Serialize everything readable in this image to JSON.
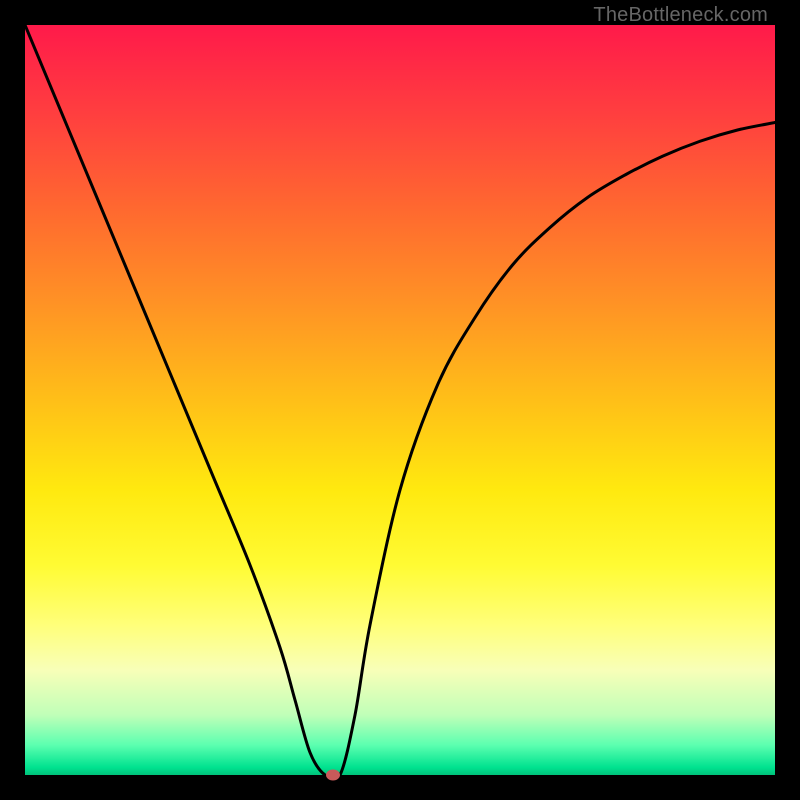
{
  "watermark": "TheBottleneck.com",
  "chart_data": {
    "type": "line",
    "title": "",
    "xlabel": "",
    "ylabel": "",
    "xlim": [
      0,
      100
    ],
    "ylim": [
      0,
      100
    ],
    "series": [
      {
        "name": "curve",
        "x": [
          0.0,
          5.0,
          10.0,
          15.0,
          20.0,
          25.0,
          30.0,
          34.0,
          36.0,
          38.0,
          40.0,
          42.0,
          44.0,
          46.0,
          50.0,
          55.0,
          60.0,
          65.0,
          70.0,
          75.0,
          80.0,
          85.0,
          90.0,
          95.0,
          100.0
        ],
        "values": [
          100.0,
          88.0,
          76.0,
          64.0,
          52.0,
          40.0,
          28.0,
          17.0,
          10.0,
          3.0,
          0.0,
          0.0,
          8.0,
          20.0,
          38.0,
          52.0,
          61.0,
          68.0,
          73.0,
          77.0,
          80.0,
          82.5,
          84.5,
          86.0,
          87.0
        ]
      }
    ],
    "marker": {
      "x": 41.0,
      "y": 0.0,
      "color": "#c85a5a"
    },
    "background_gradient": {
      "top": "#ff1a4a",
      "mid": "#ffe90f",
      "bottom": "#00c27a"
    }
  }
}
